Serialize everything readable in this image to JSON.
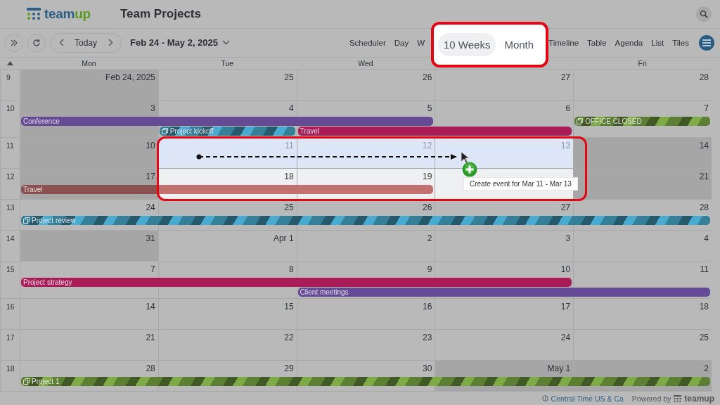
{
  "header": {
    "logo": [
      "team",
      "up"
    ],
    "title": "Team Projects"
  },
  "toolbar": {
    "today": "Today",
    "date_range": "Feb 24 - May 2, 2025",
    "views_left": [
      "Scheduler",
      "Day",
      "W"
    ],
    "views_right": [
      "Timeline",
      "Table",
      "Agenda",
      "List",
      "Tiles"
    ]
  },
  "view_popout": [
    {
      "label": "10 Weeks",
      "selected": true
    },
    {
      "label": "Month",
      "selected": false
    }
  ],
  "day_headers": [
    {
      "kind": "label",
      "label": "Mon"
    },
    {
      "kind": "label",
      "label": "Tue"
    },
    {
      "kind": "label",
      "label": "Wed"
    },
    {
      "kind": "covered"
    },
    {
      "kind": "label",
      "label": "Fri"
    }
  ],
  "weeks": [
    {
      "number": "9",
      "days": [
        {
          "label": "Feb 24, 2025",
          "shaded": true
        },
        {
          "label": "25"
        },
        {
          "label": "26"
        },
        {
          "label": "27"
        },
        {
          "label": "28"
        }
      ]
    },
    {
      "number": "10",
      "days": [
        {
          "label": "3",
          "shaded": true
        },
        {
          "label": "4"
        },
        {
          "label": "5"
        },
        {
          "label": "6"
        },
        {
          "label": "7"
        }
      ],
      "lanes": [
        [
          {
            "kind": "solid",
            "title": "Conference",
            "color": "#654b95"
          },
          {
            "kind": "cont"
          },
          {
            "kind": "cont"
          },
          {
            "kind": "free"
          },
          {
            "kind": "striped",
            "title": "OFFICE CLOSED",
            "color": "#5d7f34",
            "copy_icon": true
          }
        ],
        [
          {
            "kind": "free"
          },
          {
            "kind": "striped",
            "title": "Project kickoff",
            "color": "#357f99",
            "copy_icon": true
          },
          {
            "kind": "solid",
            "title": "Travel",
            "color": "#a91c58"
          },
          {
            "kind": "cont"
          },
          {
            "kind": "free"
          }
        ]
      ]
    },
    {
      "number": "11",
      "days": [
        {
          "label": "10",
          "shaded": true
        },
        {
          "label": "11",
          "in_range": true
        },
        {
          "label": "12",
          "in_range": true
        },
        {
          "label": "13",
          "in_range": true
        },
        {
          "label": "14",
          "shaded": true
        }
      ]
    },
    {
      "number": "12",
      "days": [
        {
          "label": "17",
          "shaded": true
        },
        {
          "label": "18",
          "focus": true
        },
        {
          "label": "19",
          "focus": true
        },
        {
          "focus": true
        },
        {
          "label": "21",
          "shaded": true
        }
      ],
      "lanes": [
        [
          {
            "kind": "solid",
            "title": "Travel",
            "color": "#8b5050"
          },
          {
            "kind": "cont"
          },
          {
            "kind": "cont"
          },
          {
            "kind": "free"
          },
          {
            "kind": "free"
          }
        ]
      ]
    },
    {
      "number": "13",
      "days": [
        {
          "label": "24"
        },
        {
          "label": "25"
        },
        {
          "label": "26"
        },
        {
          "label": "27"
        },
        {
          "label": "28"
        }
      ],
      "lanes": [
        [
          {
            "kind": "striped",
            "title": "Project review",
            "color": "#357f99",
            "copy_icon": true
          },
          {
            "kind": "cont"
          },
          {
            "kind": "cont"
          },
          {
            "kind": "cont"
          },
          {
            "kind": "cont"
          }
        ]
      ]
    },
    {
      "number": "14",
      "days": [
        {
          "label": "31",
          "shaded": true
        },
        {
          "label": "Apr 1"
        },
        {
          "label": "2"
        },
        {
          "label": "3"
        },
        {
          "label": "4"
        }
      ]
    },
    {
      "number": "15",
      "days": [
        {
          "label": "7"
        },
        {
          "label": "8"
        },
        {
          "label": "9"
        },
        {
          "label": "10"
        },
        {
          "label": "11"
        }
      ],
      "lanes": [
        [
          {
            "kind": "solid",
            "title": "Project strategy",
            "color": "#a91c58"
          },
          {
            "kind": "cont"
          },
          {
            "kind": "cont"
          },
          {
            "kind": "cont"
          },
          {
            "kind": "free"
          }
        ],
        [
          {
            "kind": "free"
          },
          {
            "kind": "free"
          },
          {
            "kind": "solid",
            "title": "Client meetings",
            "color": "#654b95"
          },
          {
            "kind": "cont"
          },
          {
            "kind": "cont"
          }
        ]
      ]
    },
    {
      "number": "16",
      "days": [
        {
          "label": "14"
        },
        {
          "label": "15"
        },
        {
          "label": "16"
        },
        {
          "label": "17"
        },
        {
          "label": "18"
        }
      ]
    },
    {
      "number": "17",
      "days": [
        {
          "label": "21"
        },
        {
          "label": "22"
        },
        {
          "label": "23"
        },
        {
          "label": "24"
        },
        {
          "label": "25"
        }
      ]
    },
    {
      "number": "18",
      "days": [
        {
          "label": "28"
        },
        {
          "label": "29"
        },
        {
          "label": "30"
        },
        {
          "label": "May 1",
          "shaded": true
        },
        {
          "label": "2",
          "shaded": true
        }
      ],
      "lanes": [
        [
          {
            "kind": "striped",
            "title": "Project 1",
            "color": "#5d7f34",
            "copy_icon": true
          },
          {
            "kind": "cont"
          },
          {
            "kind": "cont"
          },
          {
            "kind": "cont"
          },
          {
            "kind": "cont"
          }
        ]
      ]
    }
  ],
  "tooltip": "Create event for Mar 11 - Mar 13",
  "footer": {
    "timezone": "Central Time US & Ca",
    "powered_by": "Powered by",
    "logo": "teamup"
  }
}
